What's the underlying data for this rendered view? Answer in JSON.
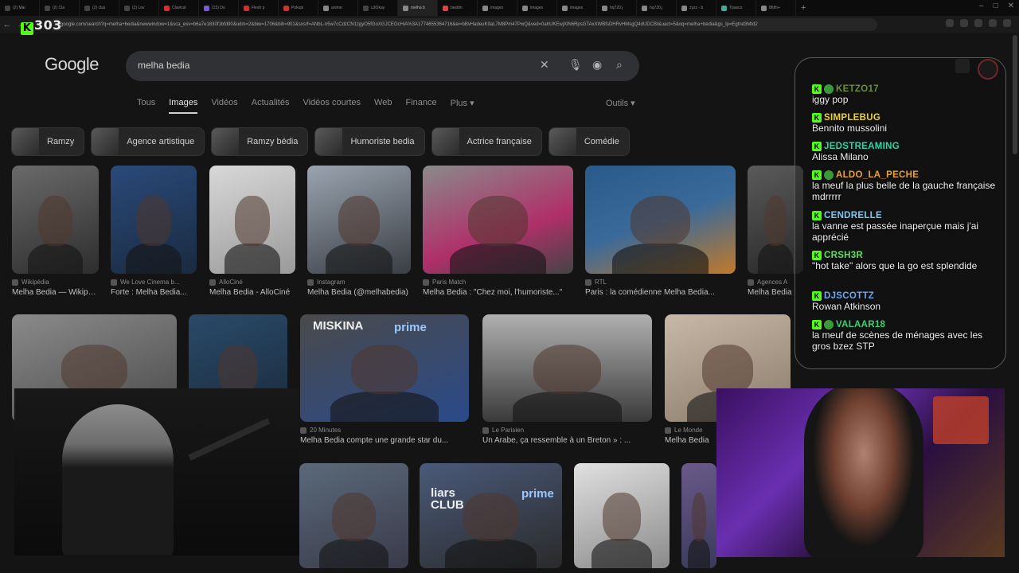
{
  "browser": {
    "tabs": [
      {
        "label": "(2) Mai",
        "color": "#444"
      },
      {
        "label": "(2) Cla",
        "color": "#444"
      },
      {
        "label": "(2) clas",
        "color": "#444"
      },
      {
        "label": "(2) Lov",
        "color": "#444"
      },
      {
        "label": "Clavicul",
        "color": "#c33"
      },
      {
        "label": "(15) Do",
        "color": "#7a5ad0"
      },
      {
        "label": "Flesh p",
        "color": "#c33"
      },
      {
        "label": "Pokopi",
        "color": "#c33"
      },
      {
        "label": "anime",
        "color": "#888"
      },
      {
        "label": "u3Okay",
        "color": "#444"
      },
      {
        "label": "melha b",
        "color": "#888",
        "active": true
      },
      {
        "label": "bestim",
        "color": "#d44"
      },
      {
        "label": "images",
        "color": "#888"
      },
      {
        "label": "images",
        "color": "#888"
      },
      {
        "label": "images",
        "color": "#888"
      },
      {
        "label": "hq720.j",
        "color": "#888"
      },
      {
        "label": "hq720.j",
        "color": "#888"
      },
      {
        "label": "zyzz - b",
        "color": "#888"
      },
      {
        "label": "Tpasco",
        "color": "#4a9"
      },
      {
        "label": "8fdfn+",
        "color": "#888"
      }
    ],
    "url": "google.com/search?q=melha+bedia&newwindow=1&sca_esv=b6a7e1830f1bfd90&udm=2&biw=1706&bih=901&sxsrf=ANbL-n5w7cCdzCN1zgyO5fGoXGJCEOcHiA%3A1774655364716&ei=bBvHadeuK9aL7M8Pm47PwQ&ved=0ahUKEwjXlN6RpsGTAxXWBfsDHRvHMsgQ4dUDCBI&uact=5&oq=melha+bedia&gs_lp=Egtnd3Mtd2"
  },
  "overlay_brand": {
    "k": "K",
    "text": "303"
  },
  "google": {
    "logo": "Google",
    "query": "melha bedia",
    "nav": [
      "Tous",
      "Images",
      "Vidéos",
      "Actualités",
      "Vidéos courtes",
      "Web",
      "Finance",
      "Plus ▾"
    ],
    "active_nav": "Images",
    "tools": "Outils ▾"
  },
  "chips": [
    "Ramzy",
    "Agence artistique",
    "Ramzy bédia",
    "Humoriste bedia",
    "Actrice française",
    "Comédie"
  ],
  "results_row1": [
    {
      "source": "Wikipédia",
      "caption": "Melha Bedia — Wikipédia"
    },
    {
      "source": "We Love Cinema b...",
      "caption": "Forte : Melha Bedia..."
    },
    {
      "source": "AlloCiné",
      "caption": "Melha Bedia - AlloCiné"
    },
    {
      "source": "Instagram",
      "caption": "Melha Bedia (@melhabedia)"
    },
    {
      "source": "Paris Match",
      "caption": "Melha Bedia : \"Chez moi, l'humoriste...\""
    },
    {
      "source": "RTL",
      "caption": "Paris : la comédienne Melha Bedia..."
    },
    {
      "source": "Agences A",
      "caption": "Melha Bedia"
    }
  ],
  "results_row2": [
    {
      "source": "",
      "caption": ""
    },
    {
      "source": "",
      "caption": ""
    },
    {
      "source": "20 Minutes",
      "caption": "Melha Bedia compte une grande star du..."
    },
    {
      "source": "Le Parisien",
      "caption": "Un Arabe, ça ressemble à un Breton » : ..."
    },
    {
      "source": "Le Monde",
      "caption": "Melha Bedia"
    }
  ],
  "image_texts": {
    "miskina": "MISKINA",
    "prime": "prime",
    "liars": "liars CLUB"
  },
  "chat": [
    {
      "user": "KETZO17",
      "color": "#6b8f3a",
      "emote": true,
      "text": "iggy pop"
    },
    {
      "user": "SIMPLEBUG",
      "color": "#e8d23a",
      "emote": false,
      "text": "Bennito mussolini"
    },
    {
      "user": "JEDSTREAMING",
      "color": "#2bd4a8",
      "emote": false,
      "text": "Alissa Milano"
    },
    {
      "user": "ALDO_LA_PECHE",
      "color": "#e8a23a",
      "emote": true,
      "text": "la meuf la plus belle de la gauche française mdrrrrr"
    },
    {
      "user": "CENDRELLE",
      "color": "#7ec8f0",
      "emote": false,
      "text": "la vanne est passée inaperçue mais j'ai apprécié"
    },
    {
      "user": "CRSH3R",
      "color": "#5ae05a",
      "emote": false,
      "text": "\"hot take\" alors que la go est splendide"
    },
    {
      "user": "DJSCOTTZ",
      "color": "#6fa8f0",
      "emote": false,
      "text": "Rowan Atkinson"
    },
    {
      "user": "VALAAR18",
      "color": "#3ad07a",
      "emote": true,
      "text": "la meuf de scènes de ménages avec les gros bzez STP"
    }
  ]
}
